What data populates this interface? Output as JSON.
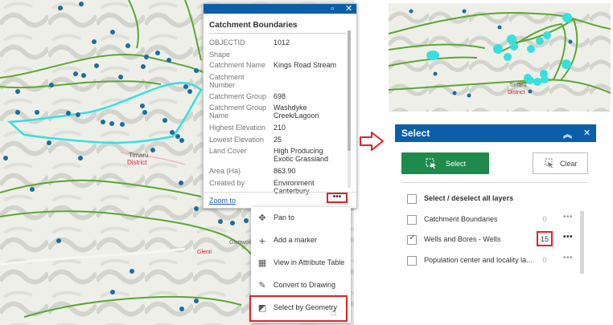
{
  "map": {
    "town_label": "Timaru",
    "district_label": "District",
    "place_label_1": "Glenwood",
    "place_label_2": "Glenti"
  },
  "popup": {
    "title": "Catchment Boundaries",
    "attributes": [
      {
        "label": "OBJECTID",
        "value": "1012"
      },
      {
        "label": "Shape",
        "value": ""
      },
      {
        "label": "Catchment Name",
        "value": "Kings Road Stream"
      },
      {
        "label": "Catchment Number",
        "value": ""
      },
      {
        "label": "Catchment Group",
        "value": "698"
      },
      {
        "label": "Catchment Group Name",
        "value": "Washdyke Creek/Lagoon"
      },
      {
        "label": "Highest Elevation",
        "value": "210"
      },
      {
        "label": "Lowest Elevation",
        "value": "25"
      },
      {
        "label": "Land Cover",
        "value": "High Producing Exotic Grassland"
      },
      {
        "label": "Area (Ha)",
        "value": "863.90"
      },
      {
        "label": "Created by",
        "value": "Environment Canterbury"
      }
    ],
    "zoom_link": "Zoom to",
    "more_label": "•••"
  },
  "context_menu": {
    "items": [
      {
        "label": "Pan to",
        "icon": "pan-icon"
      },
      {
        "label": "Add a marker",
        "icon": "plus-icon"
      },
      {
        "label": "View in Attribute Table",
        "icon": "table-icon"
      },
      {
        "label": "Convert to Drawing",
        "icon": "draw-icon"
      },
      {
        "label": "Select by Geometry",
        "icon": "select-geometry-icon"
      }
    ]
  },
  "select_panel": {
    "title": "Select",
    "select_button": "Select",
    "clear_button": "Clear",
    "all_layers_label": "Select / deselect all layers",
    "layers": [
      {
        "label": "Catchment Boundaries",
        "count": "0",
        "checked": false
      },
      {
        "label": "Wells and Bores - Wells",
        "count": "15",
        "checked": true
      },
      {
        "label": "Population center and locality la...",
        "count": "0",
        "checked": false
      }
    ]
  },
  "colors": {
    "header_blue": "#0b5ea8",
    "select_green": "#1e8a4c",
    "highlight_red": "#d6262b",
    "catchment_cyan": "#36e0e0",
    "boundary_green": "#5aa832",
    "well_point_blue": "#1a6f9e"
  }
}
